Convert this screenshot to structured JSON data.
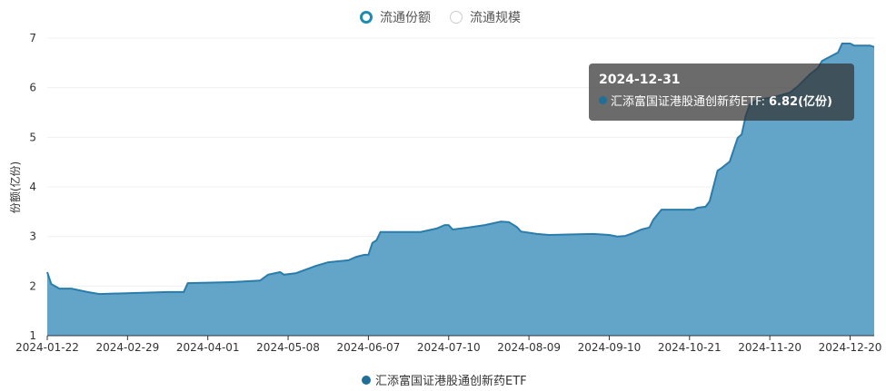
{
  "toggles": [
    {
      "label": "流通份额",
      "selected": true
    },
    {
      "label": "流通规模",
      "selected": false
    }
  ],
  "colors": {
    "accent": "#1e8bb0",
    "fill": "#62a5c9",
    "line": "#2a7dab",
    "legend_dot": "#1f6f97"
  },
  "tooltip": {
    "date": "2024-12-31",
    "series": "汇添富国证港股通创新药ETF:",
    "value": "6.82(亿份)"
  },
  "chart_data": {
    "type": "area",
    "title": "",
    "xlabel": "",
    "ylabel": "份额(亿份)",
    "ylim": [
      1,
      7
    ],
    "yticks": [
      "1",
      "2",
      "3",
      "4",
      "5",
      "6",
      "7"
    ],
    "xlim": [
      0,
      206
    ],
    "x_unit": "trading-day index",
    "xticks": [
      {
        "x": 0,
        "label": "2024-01-22"
      },
      {
        "x": 20,
        "label": "2024-02-29"
      },
      {
        "x": 40,
        "label": "2024-04-01"
      },
      {
        "x": 60,
        "label": "2024-05-08"
      },
      {
        "x": 80,
        "label": "2024-06-07"
      },
      {
        "x": 100,
        "label": "2024-07-10"
      },
      {
        "x": 120,
        "label": "2024-08-09"
      },
      {
        "x": 140,
        "label": "2024-09-10"
      },
      {
        "x": 160,
        "label": "2024-10-21"
      },
      {
        "x": 180,
        "label": "2024-11-20"
      },
      {
        "x": 200,
        "label": "2024-12-20"
      }
    ],
    "legend": {
      "position": "bottom",
      "label": "汇添富国证港股通创新药ETF"
    },
    "series": [
      {
        "name": "汇添富国证港股通创新药ETF",
        "points": [
          [
            0,
            2.28
          ],
          [
            1,
            2.04
          ],
          [
            3,
            1.95
          ],
          [
            6,
            1.95
          ],
          [
            10,
            1.88
          ],
          [
            13,
            1.84
          ],
          [
            30,
            1.88
          ],
          [
            34,
            1.88
          ],
          [
            35,
            2.06
          ],
          [
            46,
            2.08
          ],
          [
            53,
            2.11
          ],
          [
            55,
            2.23
          ],
          [
            58,
            2.28
          ],
          [
            59,
            2.23
          ],
          [
            62,
            2.26
          ],
          [
            64,
            2.32
          ],
          [
            67,
            2.41
          ],
          [
            70,
            2.48
          ],
          [
            75,
            2.52
          ],
          [
            77,
            2.59
          ],
          [
            79,
            2.63
          ],
          [
            80,
            2.63
          ],
          [
            81,
            2.87
          ],
          [
            82,
            2.92
          ],
          [
            83,
            3.09
          ],
          [
            93,
            3.09
          ],
          [
            97,
            3.16
          ],
          [
            99,
            3.23
          ],
          [
            100,
            3.23
          ],
          [
            101,
            3.14
          ],
          [
            105,
            3.18
          ],
          [
            109,
            3.23
          ],
          [
            113,
            3.3
          ],
          [
            115,
            3.29
          ],
          [
            117,
            3.19
          ],
          [
            118,
            3.1
          ],
          [
            122,
            3.05
          ],
          [
            125,
            3.03
          ],
          [
            136,
            3.05
          ],
          [
            140,
            3.03
          ],
          [
            142,
            3.0
          ],
          [
            144,
            3.01
          ],
          [
            146,
            3.07
          ],
          [
            148,
            3.14
          ],
          [
            150,
            3.18
          ],
          [
            151,
            3.34
          ],
          [
            153,
            3.54
          ],
          [
            161,
            3.54
          ],
          [
            162,
            3.58
          ],
          [
            164,
            3.6
          ],
          [
            165,
            3.71
          ],
          [
            167,
            4.33
          ],
          [
            168,
            4.38
          ],
          [
            170,
            4.51
          ],
          [
            172,
            4.99
          ],
          [
            173,
            5.06
          ],
          [
            174,
            5.43
          ],
          [
            175,
            5.66
          ],
          [
            177,
            5.76
          ],
          [
            181,
            5.81
          ],
          [
            185,
            5.9
          ],
          [
            187,
            6.03
          ],
          [
            190,
            6.27
          ],
          [
            192,
            6.4
          ],
          [
            193,
            6.54
          ],
          [
            197,
            6.71
          ],
          [
            198,
            6.89
          ],
          [
            200,
            6.89
          ],
          [
            201,
            6.85
          ],
          [
            205,
            6.85
          ],
          [
            206,
            6.82
          ]
        ]
      }
    ]
  }
}
